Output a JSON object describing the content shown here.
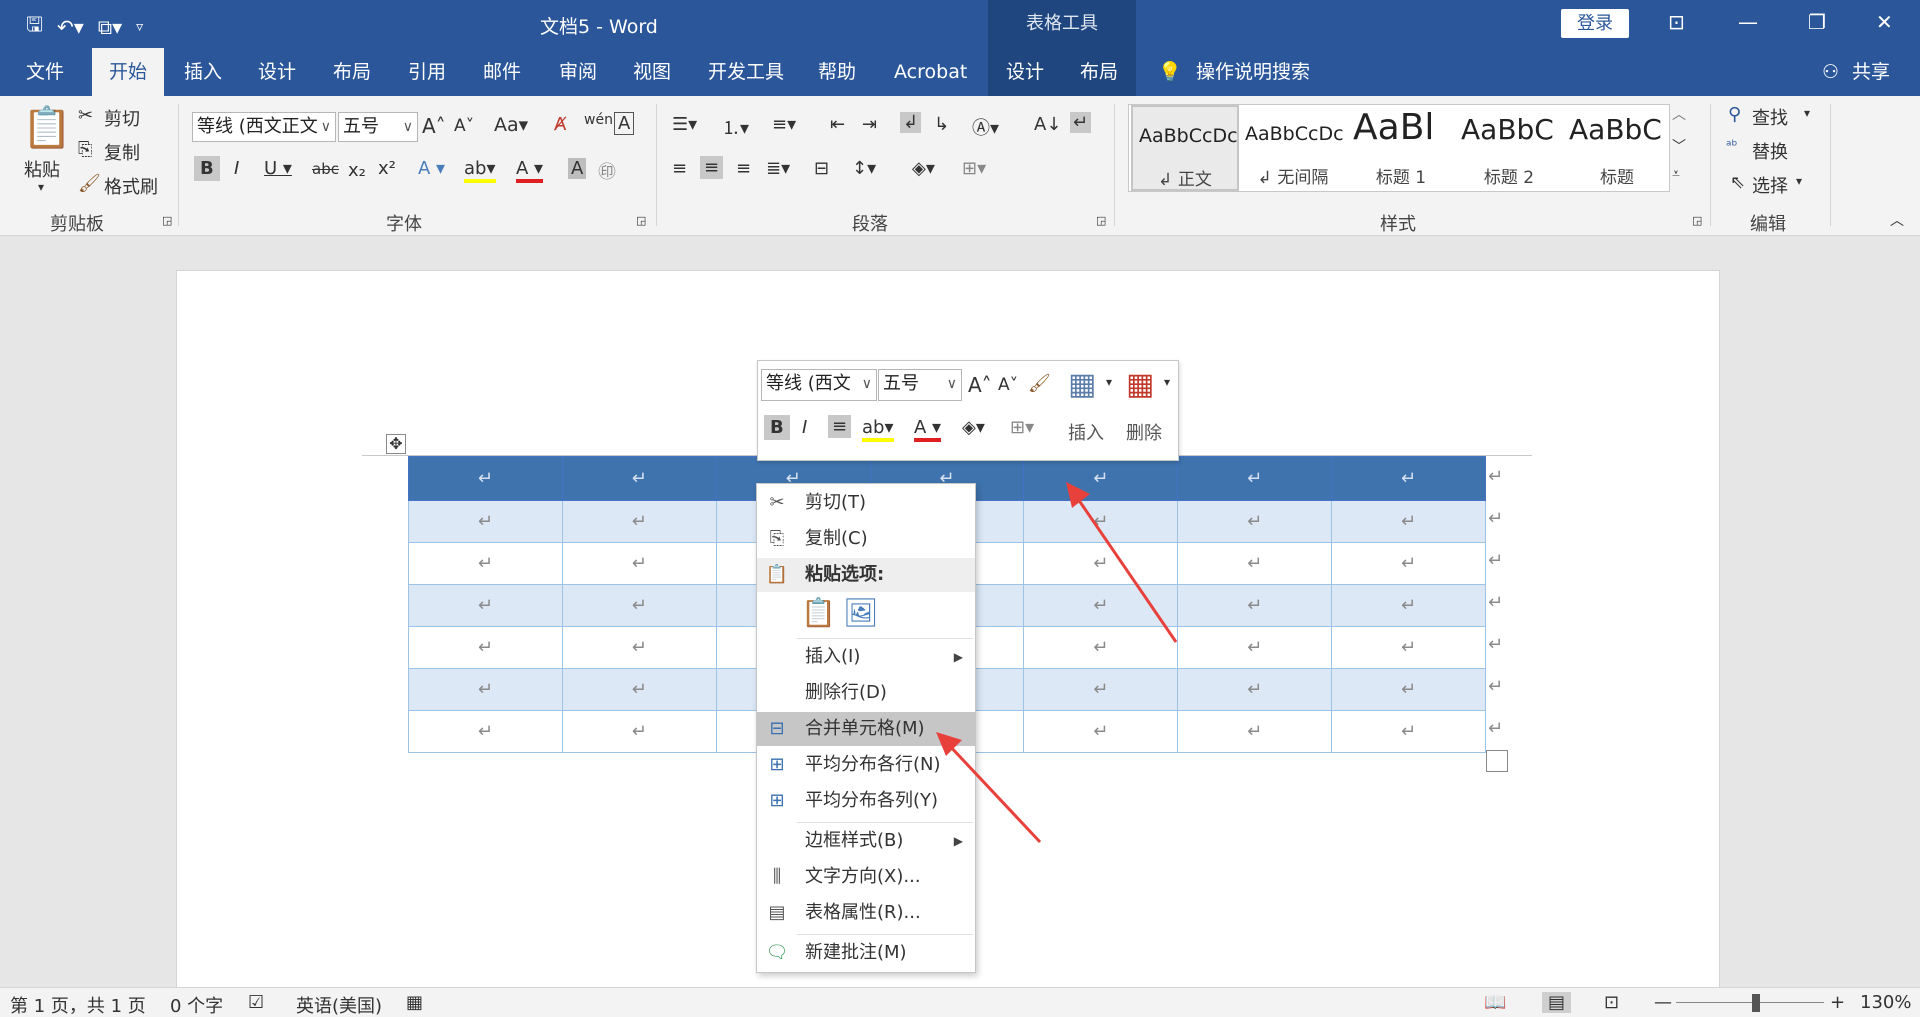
{
  "title_bar": {
    "doc_title": "文档5  -  Word",
    "context_tools": "表格工具",
    "login_label": "登录",
    "icons": [
      "save-icon",
      "undo-icon",
      "touch-mode-icon",
      "customize-qat-icon"
    ]
  },
  "tabs": [
    {
      "label": "文件"
    },
    {
      "label": "开始"
    },
    {
      "label": "插入"
    },
    {
      "label": "设计"
    },
    {
      "label": "布局"
    },
    {
      "label": "引用"
    },
    {
      "label": "邮件"
    },
    {
      "label": "审阅"
    },
    {
      "label": "视图"
    },
    {
      "label": "开发工具"
    },
    {
      "label": "帮助"
    },
    {
      "label": "Acrobat"
    },
    {
      "label": "设计"
    },
    {
      "label": "布局"
    }
  ],
  "tell_me": "操作说明搜索",
  "share": "共享",
  "ribbon": {
    "clipboard": {
      "label": "剪贴板",
      "paste": "粘贴",
      "cut": "剪切",
      "copy": "复制",
      "format_painter": "格式刷"
    },
    "font": {
      "label": "字体",
      "font_name": "等线 (西文正文",
      "font_size": "五号"
    },
    "paragraph": {
      "label": "段落"
    },
    "styles": {
      "label": "样式",
      "items": [
        {
          "sample": "AaBbCcDc",
          "name": "↲ 正文"
        },
        {
          "sample": "AaBbCcDc",
          "name": "↲ 无间隔"
        },
        {
          "sample": "AaBl",
          "name": "标题 1"
        },
        {
          "sample": "AaBbC",
          "name": "标题 2"
        },
        {
          "sample": "AaBbC",
          "name": "标题"
        }
      ]
    },
    "editing": {
      "label": "编辑",
      "find": "查找",
      "replace": "替换",
      "select": "选择"
    }
  },
  "mini_toolbar": {
    "font_name": "等线 (西文",
    "font_size": "五号",
    "insert": "插入",
    "delete": "删除"
  },
  "context_menu": {
    "cut": "剪切(T)",
    "copy": "复制(C)",
    "paste_options": "粘贴选项:",
    "insert": "插入(I)",
    "delete_row": "删除行(D)",
    "merge_cells": "合并单元格(M)",
    "distribute_rows": "平均分布各行(N)",
    "distribute_cols": "平均分布各列(Y)",
    "border_style": "边框样式(B)",
    "text_direction": "文字方向(X)...",
    "table_properties": "表格属性(R)...",
    "new_comment": "新建批注(M)"
  },
  "status_bar": {
    "page": "第 1 页，共 1 页",
    "words": "0 个字",
    "language": "英语(美国)",
    "zoom": "130%"
  },
  "table": {
    "rows": 7,
    "cols": 7,
    "para_mark": "↵"
  },
  "colors": {
    "brand": "#2b579a",
    "arrow": "#e8413c",
    "table_header": "#3f73ad",
    "band": "#dce8f6"
  }
}
